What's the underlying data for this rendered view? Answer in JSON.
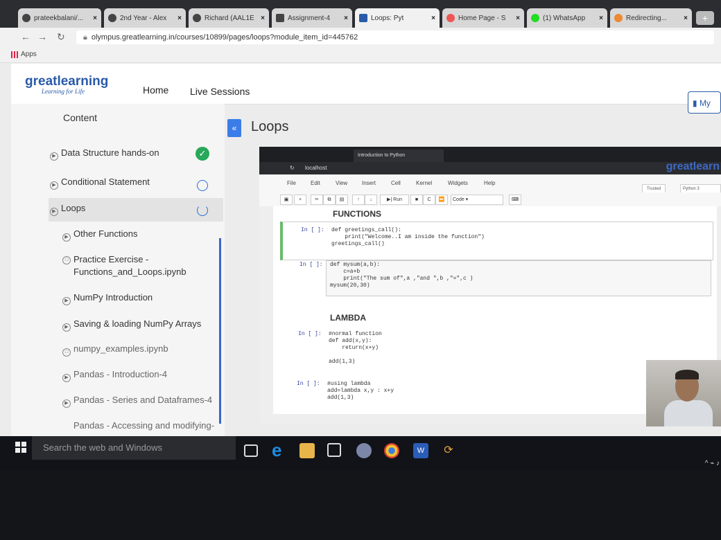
{
  "browser": {
    "tabs": [
      {
        "label": "prateekbalani/...",
        "active": false
      },
      {
        "label": "2nd Year - Alex",
        "active": false
      },
      {
        "label": "Richard (AAL1E",
        "active": false
      },
      {
        "label": "Assignment-4",
        "active": false
      },
      {
        "label": "Loops: Pyt",
        "active": true
      },
      {
        "label": "Home Page - S",
        "active": false
      },
      {
        "label": "(1) WhatsApp",
        "active": false
      },
      {
        "label": "Redirecting...",
        "active": false
      }
    ],
    "url": "olympus.greatlearning.in/courses/10899/pages/loops?module_item_id=445762",
    "bookmarks_label": "Apps"
  },
  "site": {
    "logo": "greatlearning",
    "tagline": "Learning for Life",
    "nav": [
      "Home",
      "Live Sessions"
    ],
    "my_button": "My"
  },
  "sidebar": {
    "title": "Content",
    "items": [
      {
        "label": "Data Structure hands-on",
        "status": "done"
      },
      {
        "label": "Conditional Statement",
        "status": "todo"
      },
      {
        "label": "Loops",
        "status": "progress"
      },
      {
        "label": "Other Functions",
        "status": ""
      },
      {
        "label": "Practice Exercise - Functions_and_Loops.ipynb",
        "status": ""
      },
      {
        "label": "NumPy Introduction",
        "status": ""
      },
      {
        "label": "Saving & loading NumPy Arrays",
        "status": ""
      },
      {
        "label": "numpy_examples.ipynb",
        "status": ""
      },
      {
        "label": "Pandas - Introduction-4",
        "status": ""
      },
      {
        "label": "Pandas - Series and Dataframes-4",
        "status": ""
      },
      {
        "label": "Pandas - Accessing and modifying-",
        "status": ""
      }
    ],
    "collapse_icon": "«"
  },
  "page_title": "Loops",
  "jupyter": {
    "tab_label": "Introduction to Python",
    "address": "localhost",
    "brand": "greatlearn",
    "menu": [
      "File",
      "Edit",
      "View",
      "Insert",
      "Cell",
      "Kernel",
      "Widgets",
      "Help"
    ],
    "trusted": "Trusted",
    "kernel": "Python 3",
    "run_label": "Run",
    "cell_type": "Code",
    "heading_functions": "FUNCTIONS",
    "heading_lambda": "LAMBDA",
    "prompt": "In [ ]:",
    "cells": [
      "def greetings_call():\n    print(\"Welcome..I am inside the function\")\ngreetings_call()",
      "def mysum(a,b):\n    c=a+b\n    print(\"The sum of\",a ,\"and \",b ,\"=\",c )\nmysum(20,30)",
      "#normal function\ndef add(x,y):\n    return(x+y)\n\nadd(1,3)",
      "#using lambda\nadd=lambda x,y : x+y\nadd(1,3)"
    ]
  },
  "taskbar": {
    "search_placeholder": "Search the web and Windows"
  },
  "colors": {
    "accent": "#2a5aa8",
    "done": "#27a85a",
    "collapse": "#3b7de8"
  }
}
